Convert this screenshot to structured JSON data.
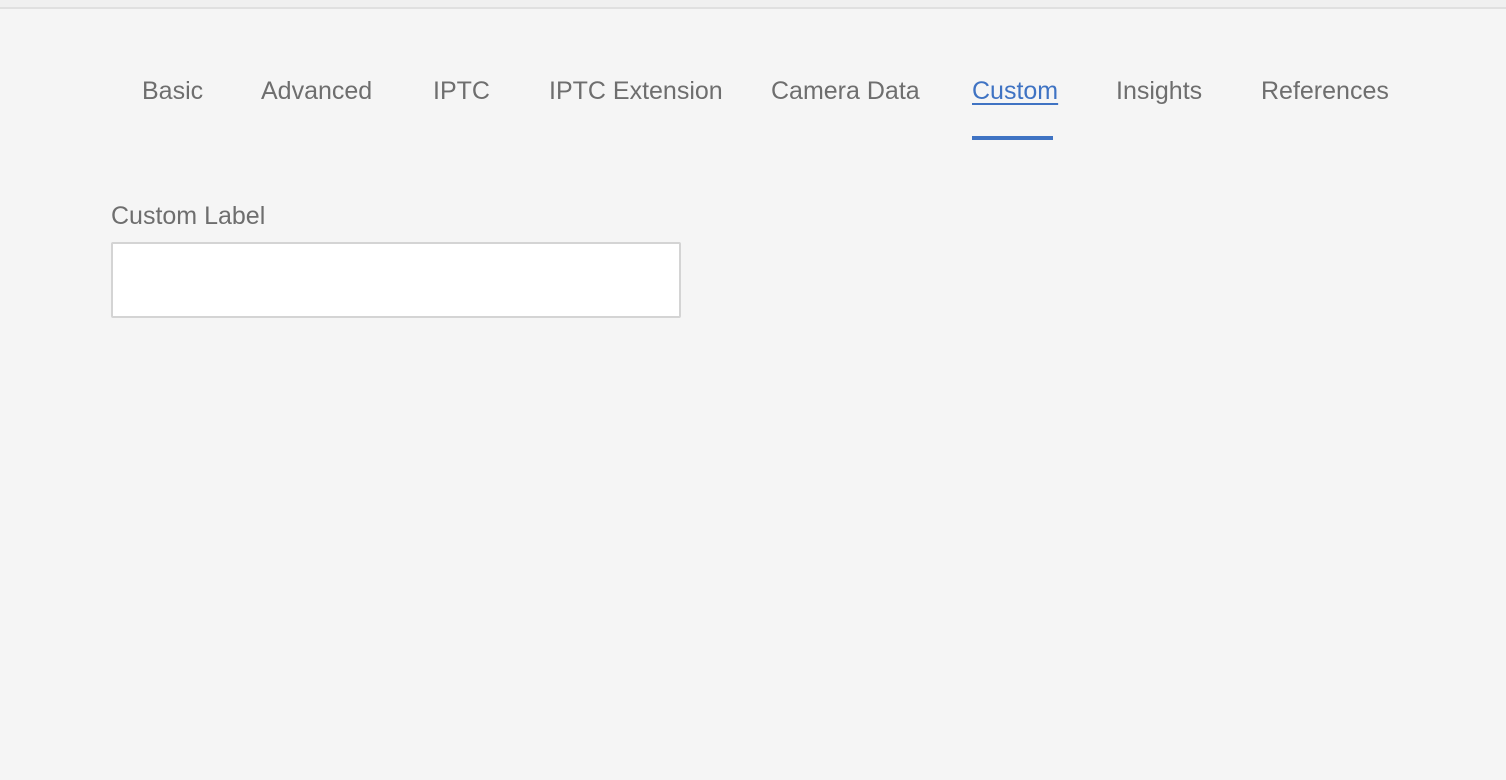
{
  "tabs": [
    {
      "id": "basic",
      "label": "Basic",
      "active": false
    },
    {
      "id": "advanced",
      "label": "Advanced",
      "active": false
    },
    {
      "id": "iptc",
      "label": "IPTC",
      "active": false
    },
    {
      "id": "iptc-extension",
      "label": "IPTC Extension",
      "active": false
    },
    {
      "id": "camera-data",
      "label": "Camera Data",
      "active": false
    },
    {
      "id": "custom",
      "label": "Custom",
      "active": true
    },
    {
      "id": "insights",
      "label": "Insights",
      "active": false
    },
    {
      "id": "references",
      "label": "References",
      "active": false
    }
  ],
  "custom_panel": {
    "custom_label_field": {
      "label": "Custom Label",
      "value": "",
      "placeholder": ""
    }
  },
  "colors": {
    "background": "#f5f5f5",
    "accent": "#3f73c3",
    "text_muted": "#6e6e6e",
    "field_border": "#d4d4d4"
  }
}
